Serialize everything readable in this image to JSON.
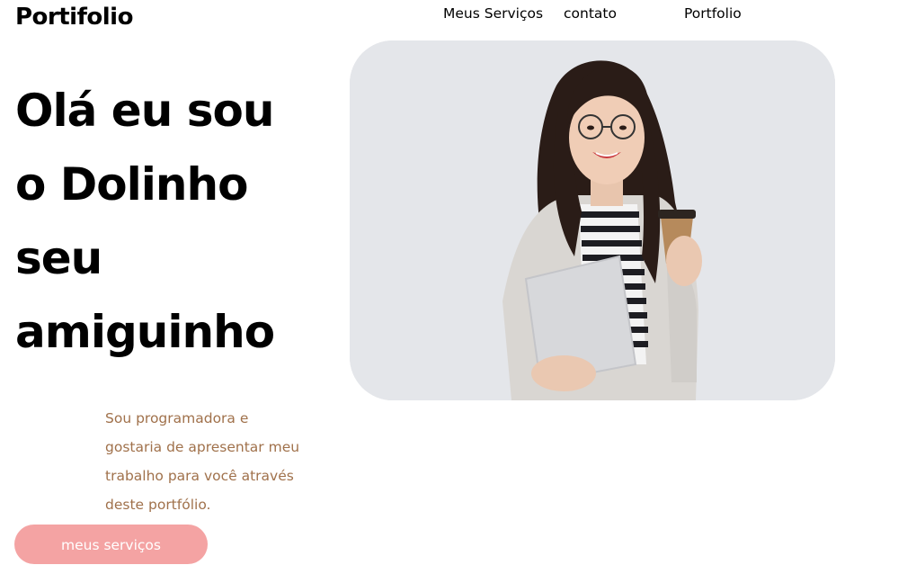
{
  "header": {
    "logo": "Portifolio",
    "nav": {
      "servicos": "Meus Serviços",
      "contato": "contato",
      "portfolio": "Portfolio"
    }
  },
  "hero": {
    "title_lines": [
      "Olá eu sou",
      "o Dolinho",
      "seu",
      "amiguinho"
    ],
    "description_lines": [
      "Sou programadora e",
      "gostaria de apresentar meu",
      "trabalho para você através",
      "deste portfólio."
    ],
    "cta_label": "meus serviços"
  },
  "colors": {
    "accent_button": "#f4a3a3",
    "description_text": "#a0714b",
    "image_background": "#e4e6ea"
  }
}
